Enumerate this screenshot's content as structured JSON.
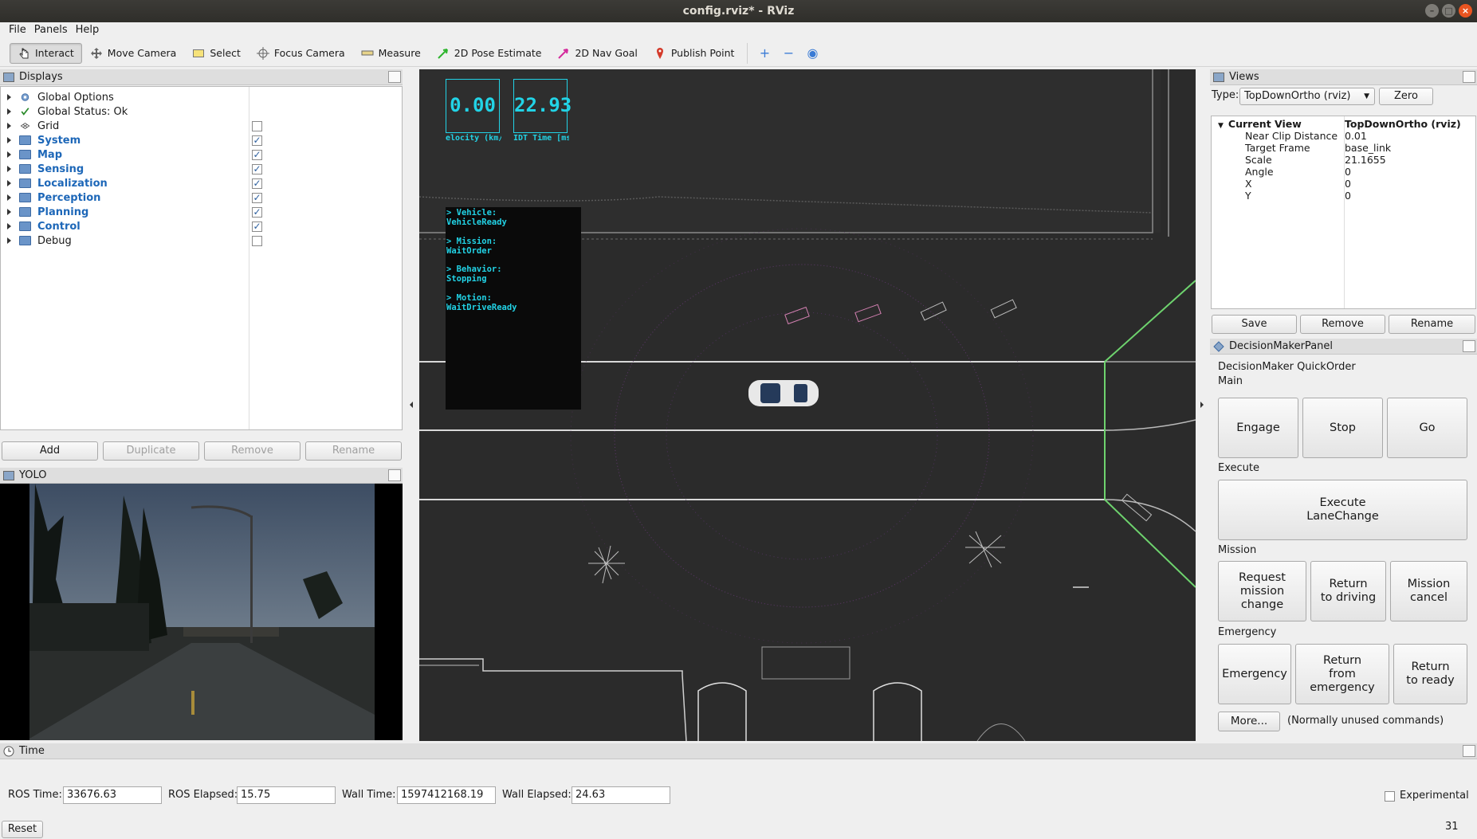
{
  "window": {
    "title": "config.rviz* - RViz"
  },
  "menu": [
    "File",
    "Panels",
    "Help"
  ],
  "toolbar": {
    "tools": [
      {
        "label": "Interact",
        "icon": "hand-cursor-icon",
        "active": true
      },
      {
        "label": "Move Camera",
        "icon": "move-camera-icon",
        "active": false
      },
      {
        "label": "Select",
        "icon": "select-box-icon",
        "active": false
      },
      {
        "label": "Focus Camera",
        "icon": "focus-crosshair-icon",
        "active": false
      },
      {
        "label": "Measure",
        "icon": "ruler-icon",
        "active": false
      },
      {
        "label": "2D Pose Estimate",
        "icon": "green-arrow-icon",
        "active": false
      },
      {
        "label": "2D Nav Goal",
        "icon": "pink-arrow-icon",
        "active": false
      },
      {
        "label": "Publish Point",
        "icon": "red-pin-icon",
        "active": false
      }
    ]
  },
  "displays": {
    "title": "Displays",
    "items": [
      {
        "label": "Global Options",
        "icon": "gear-icon",
        "bold": false,
        "checked": null
      },
      {
        "label": "Global Status: Ok",
        "icon": "checkmark-icon",
        "bold": false,
        "checked": null
      },
      {
        "label": "Grid",
        "icon": "grid-icon",
        "bold": false,
        "checked": false
      },
      {
        "label": "System",
        "icon": "folder-icon",
        "bold": true,
        "checked": true
      },
      {
        "label": "Map",
        "icon": "folder-icon",
        "bold": true,
        "checked": true
      },
      {
        "label": "Sensing",
        "icon": "folder-icon",
        "bold": true,
        "checked": true
      },
      {
        "label": "Localization",
        "icon": "folder-icon",
        "bold": true,
        "checked": true
      },
      {
        "label": "Perception",
        "icon": "folder-icon",
        "bold": true,
        "checked": true
      },
      {
        "label": "Planning",
        "icon": "folder-icon",
        "bold": true,
        "checked": true
      },
      {
        "label": "Control",
        "icon": "folder-icon",
        "bold": true,
        "checked": true
      },
      {
        "label": "Debug",
        "icon": "folder-icon",
        "bold": false,
        "checked": false
      }
    ],
    "buttons": {
      "add": "Add",
      "duplicate": "Duplicate",
      "remove": "Remove",
      "rename": "Rename"
    }
  },
  "yolo": {
    "title": "YOLO"
  },
  "overlay": {
    "velocity_value": "0.00",
    "velocity_label": "elocity (km/h",
    "idt_value": "22.93",
    "idt_label": "IDT Time [ms",
    "state_text": [
      "> Vehicle:",
      "VehicleReady",
      "",
      "> Mission:",
      "WaitOrder",
      "",
      "> Behavior:",
      "Stopping",
      "",
      "> Motion:",
      "WaitDriveReady"
    ]
  },
  "views": {
    "title": "Views",
    "type_label": "Type:",
    "type_value": "TopDownOrtho (rviz)",
    "zero_button": "Zero",
    "current_view_label": "Current View",
    "current_view_value": "TopDownOrtho (rviz)",
    "properties": [
      {
        "key": "Near Clip Distance",
        "value": "0.01"
      },
      {
        "key": "Target Frame",
        "value": "base_link"
      },
      {
        "key": "Scale",
        "value": "21.1655"
      },
      {
        "key": "Angle",
        "value": "0"
      },
      {
        "key": "X",
        "value": "0"
      },
      {
        "key": "Y",
        "value": "0"
      }
    ],
    "buttons": {
      "save": "Save",
      "remove": "Remove",
      "rename": "Rename"
    }
  },
  "decision_maker": {
    "title": "DecisionMakerPanel",
    "subtitle": "DecisionMaker QuickOrder",
    "main_label": "Main",
    "engage": "Engage",
    "stop": "Stop",
    "go": "Go",
    "execute_label": "Execute",
    "execute_lane_change": "Execute\nLaneChange",
    "mission_label": "Mission",
    "request_mission_change": "Request\nmission change",
    "return_to_driving": "Return\nto driving",
    "mission_cancel": "Mission\ncancel",
    "emergency_label": "Emergency",
    "emergency": "Emergency",
    "return_from_emergency": "Return\nfrom emergency",
    "return_to_ready": "Return\nto ready",
    "more": "More...",
    "more_note": "(Normally unused commands)"
  },
  "time": {
    "title": "Time",
    "ros_time_label": "ROS Time:",
    "ros_time": "33676.63",
    "ros_elapsed_label": "ROS Elapsed:",
    "ros_elapsed": "15.75",
    "wall_time_label": "Wall Time:",
    "wall_time": "1597412168.19",
    "wall_elapsed_label": "Wall Elapsed:",
    "wall_elapsed": "24.63",
    "experimental": "Experimental",
    "reset": "Reset",
    "fps": "31 fps"
  },
  "colors": {
    "accent_blue": "#1d67b8",
    "overlay_cyan": "#22d3e6",
    "lane_green": "#6ed36e",
    "close_orange": "#e95420"
  }
}
